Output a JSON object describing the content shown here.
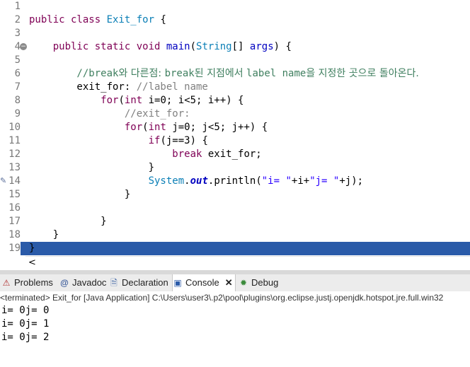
{
  "editor": {
    "line_numbers": [
      "1",
      "2",
      "3",
      "4",
      "5",
      "6",
      "7",
      "8",
      "9",
      "10",
      "11",
      "12",
      "13",
      "14",
      "15",
      "16",
      "17",
      "18",
      "19"
    ],
    "lines": [
      [],
      [
        {
          "t": "public class ",
          "c": "kw"
        },
        {
          "t": "Exit_for",
          "c": "ty"
        },
        {
          "t": " {",
          "c": ""
        }
      ],
      [],
      [
        {
          "t": "    public static void ",
          "c": "kw"
        },
        {
          "t": "main",
          "c": "nm"
        },
        {
          "t": "(",
          "c": ""
        },
        {
          "t": "String",
          "c": "ty"
        },
        {
          "t": "[] ",
          "c": ""
        },
        {
          "t": "args",
          "c": "nm"
        },
        {
          "t": ") {",
          "c": ""
        }
      ],
      [],
      [
        {
          "t": "        //break",
          "c": "cm"
        },
        {
          "t": "와 다른점: ",
          "c": "cm ko"
        },
        {
          "t": "break",
          "c": "cm"
        },
        {
          "t": "된 지점에서 ",
          "c": "cm ko"
        },
        {
          "t": "label name",
          "c": "cm"
        },
        {
          "t": "을 지정한 곳으로 돌아온다.",
          "c": "cm ko"
        }
      ],
      [
        {
          "t": "        exit_for: ",
          "c": ""
        },
        {
          "t": "//label name",
          "c": "cm2"
        }
      ],
      [
        {
          "t": "            ",
          "c": ""
        },
        {
          "t": "for",
          "c": "kw"
        },
        {
          "t": "(",
          "c": ""
        },
        {
          "t": "int",
          "c": "kw"
        },
        {
          "t": " i=0; i<5; i++) {",
          "c": ""
        }
      ],
      [
        {
          "t": "                //exit_for:",
          "c": "cm2"
        }
      ],
      [
        {
          "t": "                ",
          "c": ""
        },
        {
          "t": "for",
          "c": "kw"
        },
        {
          "t": "(",
          "c": ""
        },
        {
          "t": "int",
          "c": "kw"
        },
        {
          "t": " j=0; j<5; j++) {",
          "c": ""
        }
      ],
      [
        {
          "t": "                    ",
          "c": ""
        },
        {
          "t": "if",
          "c": "kw"
        },
        {
          "t": "(j==3) {",
          "c": ""
        }
      ],
      [
        {
          "t": "                        ",
          "c": ""
        },
        {
          "t": "break",
          "c": "kw"
        },
        {
          "t": " exit_for;",
          "c": ""
        }
      ],
      [
        {
          "t": "                    }",
          "c": ""
        }
      ],
      [
        {
          "t": "                    ",
          "c": ""
        },
        {
          "t": "System",
          "c": "ty"
        },
        {
          "t": ".",
          "c": ""
        },
        {
          "t": "out",
          "c": "fld"
        },
        {
          "t": ".println(",
          "c": ""
        },
        {
          "t": "\"i= \"",
          "c": "st"
        },
        {
          "t": "+i+",
          "c": ""
        },
        {
          "t": "\"j= \"",
          "c": "st"
        },
        {
          "t": "+j);",
          "c": ""
        }
      ],
      [
        {
          "t": "                }",
          "c": ""
        }
      ],
      [],
      [
        {
          "t": "            }",
          "c": ""
        }
      ],
      [
        {
          "t": "    }",
          "c": ""
        }
      ],
      [
        {
          "t": "}",
          "c": ""
        }
      ]
    ],
    "scroll_left_label": "<"
  },
  "views": {
    "tabs": [
      {
        "label": "Problems",
        "icon": "problems-icon"
      },
      {
        "label": "Javadoc",
        "icon": "javadoc-icon"
      },
      {
        "label": "Declaration",
        "icon": "declaration-icon"
      },
      {
        "label": "Console",
        "icon": "console-icon",
        "active": true
      },
      {
        "label": "Debug",
        "icon": "debug-icon"
      }
    ],
    "close_label": "✕"
  },
  "console": {
    "status": "<terminated> Exit_for [Java Application] C:\\Users\\user3\\.p2\\pool\\plugins\\org.eclipse.justj.openjdk.hotspot.jre.full.win32",
    "output": [
      "i= 0j= 0",
      "i= 0j= 1",
      "i= 0j= 2"
    ]
  },
  "colors": {
    "keyword": "#7f0055",
    "type": "#0b7fb6",
    "comment": "#3f7f5f",
    "string": "#2a00ff",
    "selection": "#2a5aa8"
  }
}
